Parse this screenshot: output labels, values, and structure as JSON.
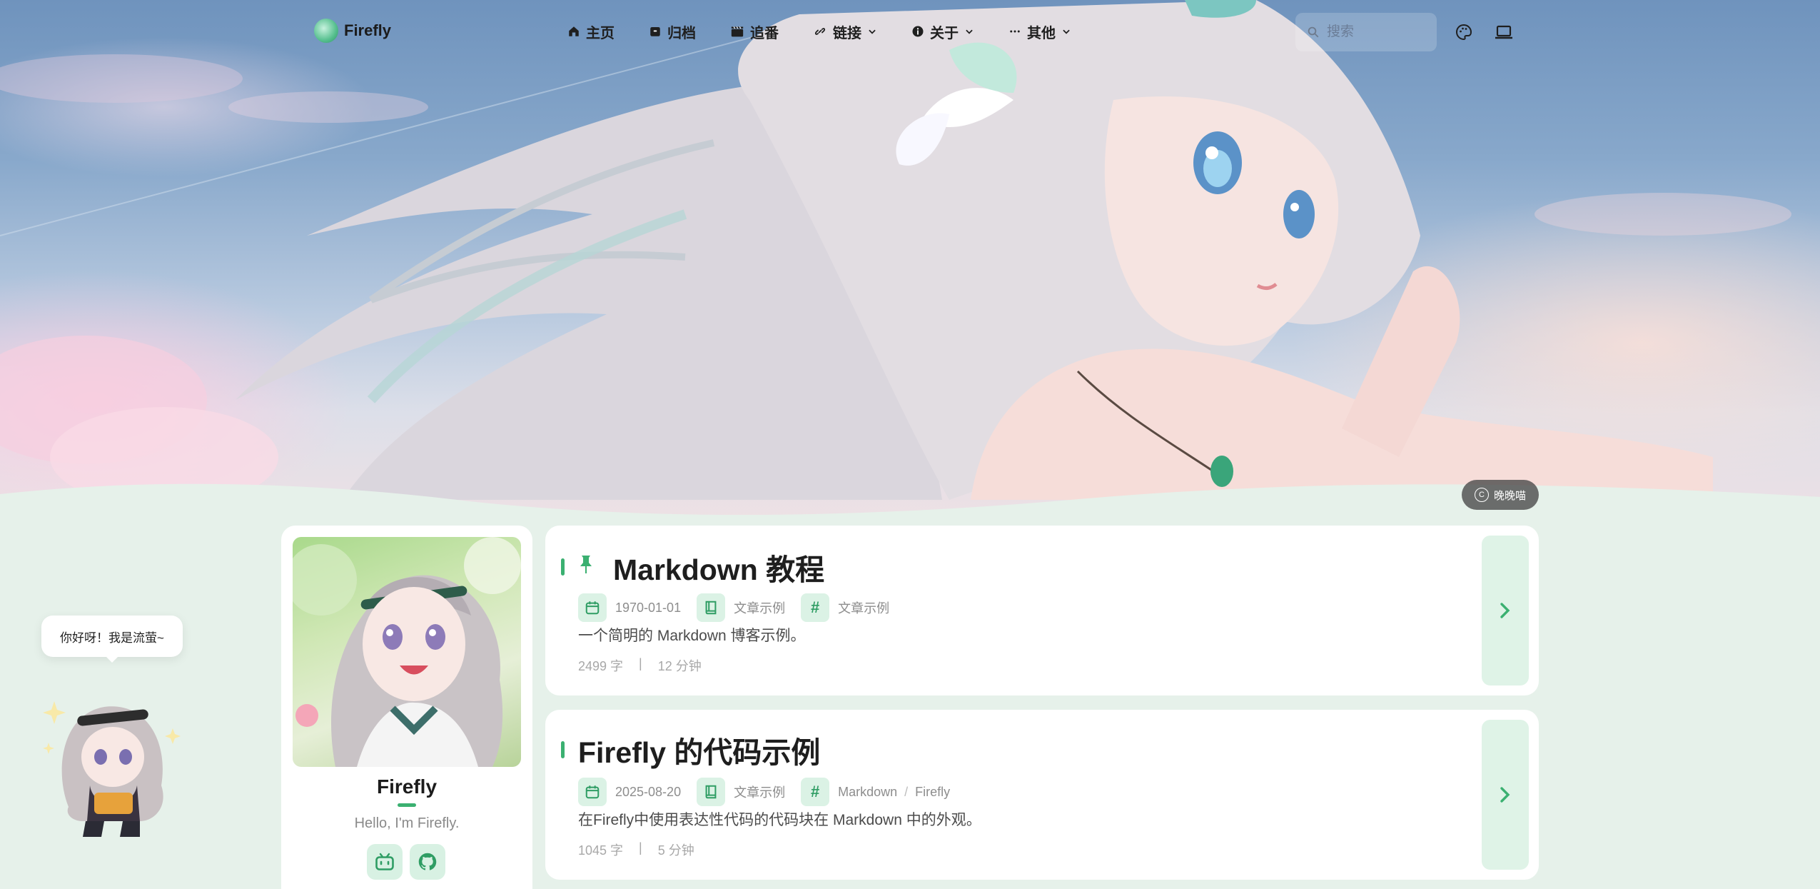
{
  "nav": {
    "logo": "Firefly",
    "menu": [
      {
        "label": "主页",
        "icon": "home-icon"
      },
      {
        "label": "归档",
        "icon": "archive-icon"
      },
      {
        "label": "追番",
        "icon": "clapperboard-icon"
      },
      {
        "label": "链接",
        "icon": "link-icon",
        "dropdown": true
      },
      {
        "label": "关于",
        "icon": "info-icon",
        "dropdown": true
      },
      {
        "label": "其他",
        "icon": "more-icon",
        "dropdown": true
      }
    ],
    "search_placeholder": "搜索"
  },
  "banner": {
    "credit": "晚晚喵"
  },
  "profile": {
    "name": "Firefly",
    "bio": "Hello, I'm Firefly.",
    "socials": [
      "bilibili-icon",
      "github-icon"
    ]
  },
  "posts": [
    {
      "pinned": true,
      "title": "Markdown 教程",
      "date": "1970-01-01",
      "category": "文章示例",
      "tags": [
        "文章示例"
      ],
      "description": "一个简明的 Markdown 博客示例。",
      "words": "2499 字",
      "read_time": "12 分钟"
    },
    {
      "pinned": false,
      "title": "Firefly 的代码示例",
      "date": "2025-08-20",
      "category": "文章示例",
      "tags": [
        "Markdown",
        "Firefly"
      ],
      "tag_separator": "/",
      "description": "在Firefly中使用表达性代码的代码块在 Markdown 中的外观。",
      "words": "1045 字",
      "read_time": "5 分钟"
    }
  ],
  "stats_separator": "|",
  "mascot": {
    "greeting": "你好呀！我是流萤~"
  },
  "colors": {
    "accent": "#3bb071",
    "accent_soft": "#dbf2e5",
    "page_bg": "#e6f1ea"
  }
}
